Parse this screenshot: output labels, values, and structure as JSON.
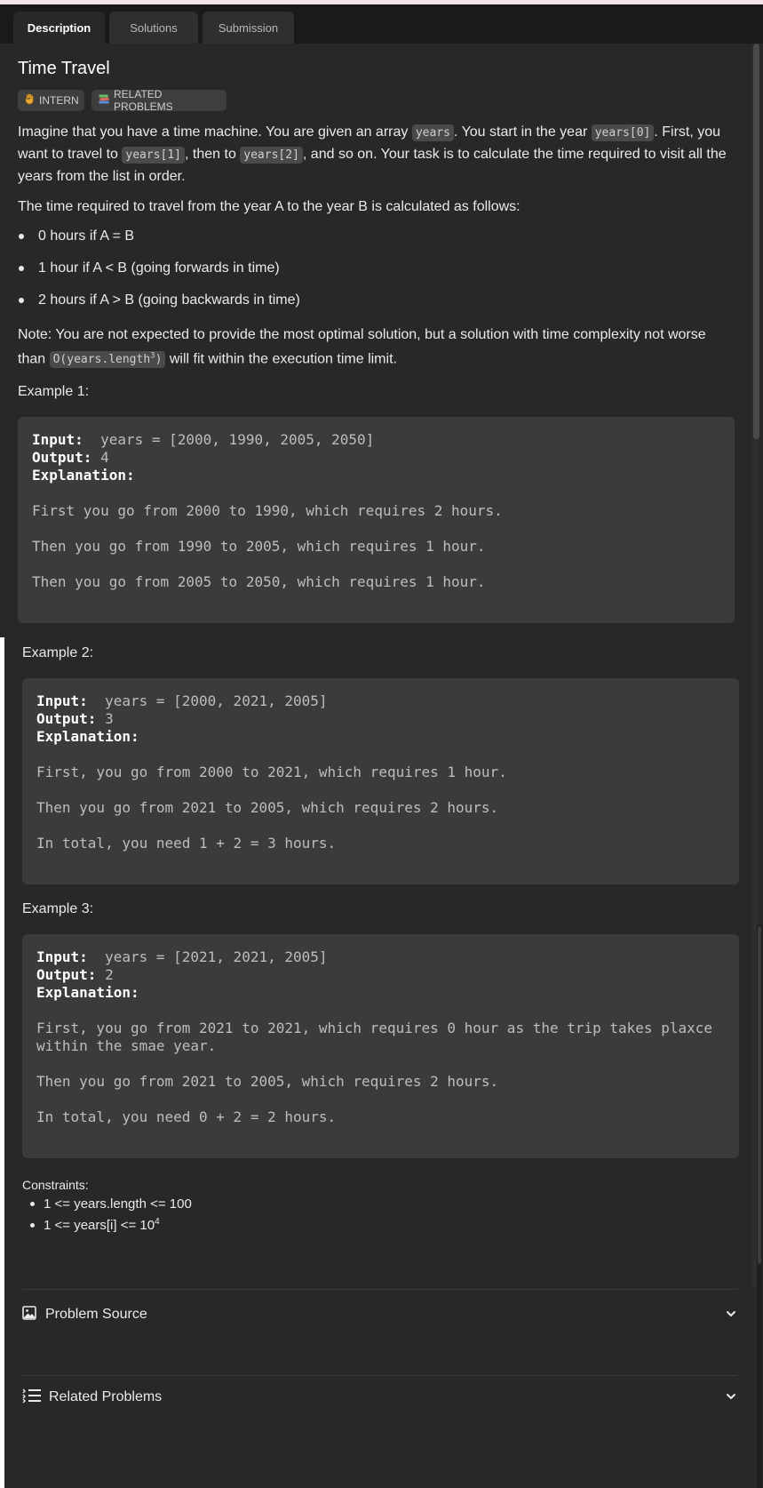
{
  "tabs": [
    "Description",
    "Solutions",
    "Submission"
  ],
  "title": "Time Travel",
  "badges": [
    {
      "icon": "hand-icon",
      "label": "INTERN"
    },
    {
      "icon": "books-icon",
      "label": "RELATED PROBLEMS"
    }
  ],
  "intro": {
    "t1": "Imagine that you have a time machine. You are given an array ",
    "c1": "years",
    "t2": ". You start in the year ",
    "c2": "years[0]",
    "t3": ". First, you want to travel to ",
    "c3": "years[1]",
    "t4": ", then to ",
    "c4": "years[2]",
    "t5": ", and so on. Your task is to calculate the time required to visit all the years from the list in order."
  },
  "rule_intro": "The time required to travel from the year A to the year B is calculated as follows:",
  "rules": [
    "0 hours if A = B",
    "1 hour if A < B (going forwards in time)",
    "2 hours if A > B (going backwards in time)"
  ],
  "note": {
    "t1": "Note: You are not expected to provide the most optimal solution, but a solution with time complexity not worse than ",
    "code": "O(years.length",
    "sup": "3",
    "code_end": ")",
    "t2": " will fit within the execution time limit."
  },
  "labels": {
    "input": "Input:",
    "output": "Output:",
    "explanation": "Explanation:"
  },
  "examples": [
    {
      "label": "Example 1:",
      "input": "years = [2000, 1990, 2005, 2050]",
      "output": "4",
      "lines": [
        "First you go from 2000 to 1990, which requires 2 hours.",
        "Then you go from 1990 to 2005, which requires 1 hour.",
        "Then you go from 2005 to 2050, which requires 1 hour."
      ]
    },
    {
      "label": "Example 2:",
      "input": "years = [2000, 2021, 2005]",
      "output": "3",
      "lines": [
        "First, you go from 2000 to 2021, which requires 1 hour.",
        "Then you go from 2021 to 2005, which requires 2 hours.",
        "In total, you need 1 + 2 = 3 hours."
      ]
    },
    {
      "label": "Example 3:",
      "input": "years = [2021, 2021, 2005]",
      "output": "2",
      "lines": [
        "First, you go from 2021 to 2021, which requires 0 hour as the trip takes plaxce",
        "within the smae year.",
        "Then you go from 2021 to 2005, which requires 2 hours.",
        "In total, you need 0 + 2 = 2 hours."
      ]
    }
  ],
  "constraints": {
    "title": "Constraints:",
    "c1": "1 <= years.length <= 100",
    "c2_text": "1 <= years[i] <= 10",
    "c2_sup": "4"
  },
  "accordions": [
    {
      "icon": "image-icon",
      "label": "Problem Source"
    },
    {
      "icon": "list-icon",
      "label": "Related Problems"
    }
  ]
}
